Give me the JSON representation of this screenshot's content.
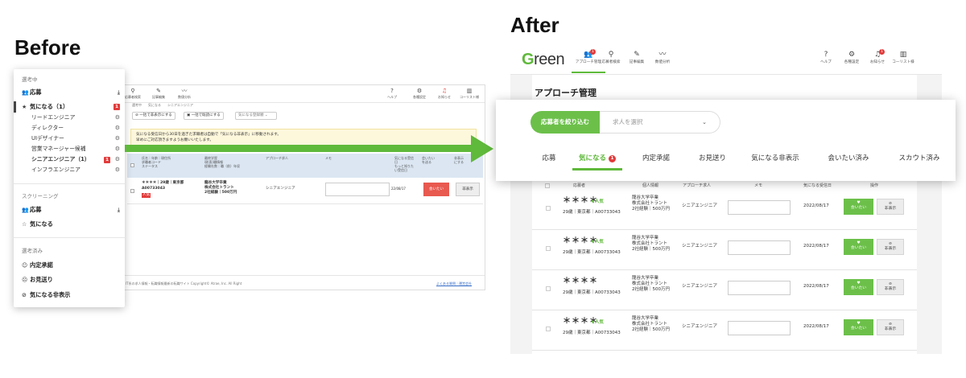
{
  "labels": {
    "before": "Before",
    "after": "After"
  },
  "colors": {
    "accent_green": "#5fb93b",
    "badge_red": "#e23b3b"
  },
  "before": {
    "nav": [
      {
        "icon": "search-icon",
        "glyph": "⚲",
        "label": "応募者検索"
      },
      {
        "icon": "pen-icon",
        "glyph": "✎",
        "label": "記事編集"
      },
      {
        "icon": "chart-icon",
        "glyph": "〰",
        "label": "数値分析"
      },
      {
        "icon": "help-icon",
        "glyph": "?",
        "label": "ヘルプ"
      },
      {
        "icon": "gear-icon",
        "glyph": "⚙",
        "label": "各種設定"
      },
      {
        "icon": "bell-icon",
        "glyph": "♫",
        "label": "お知らせ"
      },
      {
        "icon": "building-icon",
        "glyph": "▥",
        "label": "コーリスト様"
      }
    ],
    "crumbs": "選考中　　気になる　　シニアエンジニア",
    "bulk_hide": "一括で非表示にする",
    "bulk_read": "一括で既読にする",
    "sort": "気になる登録順",
    "notice_line1": "気になる受信日から30日を過ぎた求職者は自動で「気になる非表示」に移動されます。",
    "notice_line2": "早めにご対応頂きますようお願いいたします。",
    "thead": {
      "col1": "氏名｜年齢｜現住所\n求職者コード\nステータス",
      "col2": "最終学歴\n現(直)職情報\n経験社数｜職（前）年収",
      "col3": "アプローチ求人",
      "col4": "メモ",
      "col5": "気になる受信\n日\nもっと知りた\nい受信日",
      "col6": "会いたい\nを送る",
      "col7": "非表示\nにする"
    },
    "row": {
      "name": "＊＊＊＊｜29歳｜東京都",
      "code": "A00733043",
      "status": "人気",
      "edu": "龍谷大学卒業\n株式会社トラント\n2社経験｜500万円",
      "job": "シニアエンジニア",
      "date": "22/08/17",
      "meet": "会いたい",
      "hide": "非表示"
    },
    "footer_left": "IT系の求人情報・転職情報最新の転職サイト Copyright© Atrae, Inc. All Right",
    "footer_right": "よくある質問｜運営会社",
    "sidebar": {
      "sec1": "選考中",
      "apply": "応募",
      "interest": "気になる（1）",
      "interest_badge": "1",
      "subs": [
        {
          "label": "リードエンジニア",
          "badge": ""
        },
        {
          "label": "ディレクター",
          "badge": ""
        },
        {
          "label": "UIデザイナー",
          "badge": ""
        },
        {
          "label": "営業マネージャー候補",
          "badge": ""
        },
        {
          "label": "シニアエンジニア（1）",
          "badge": "1"
        },
        {
          "label": "インフラエンジニア",
          "badge": ""
        }
      ],
      "sec2": "スクリーニング",
      "screen_apply": "応募",
      "screen_interest": "気になる",
      "sec3": "選考済み",
      "offer": "内定承諾",
      "decline": "お見送り",
      "hidden": "気になる非表示"
    }
  },
  "after": {
    "logo": "Green",
    "nav": [
      {
        "icon": "users-icon",
        "glyph": "👥",
        "label": "アプローチ管理",
        "badge": "1"
      },
      {
        "icon": "search-icon",
        "glyph": "⚲",
        "label": "応募者検索",
        "badge": ""
      },
      {
        "icon": "pen-icon",
        "glyph": "✎",
        "label": "記事編集",
        "badge": ""
      },
      {
        "icon": "chart-icon",
        "glyph": "〰",
        "label": "数値分析",
        "badge": ""
      },
      {
        "icon": "help-icon",
        "glyph": "?",
        "label": "ヘルプ",
        "badge": ""
      },
      {
        "icon": "gear-icon",
        "glyph": "⚙",
        "label": "各種設定",
        "badge": ""
      },
      {
        "icon": "bell-icon",
        "glyph": "♫",
        "label": "お知らせ",
        "badge": "1"
      },
      {
        "icon": "building-icon",
        "glyph": "▥",
        "label": "コーリスト様",
        "badge": ""
      }
    ],
    "title": "アプローチ管理",
    "filter_button": "応募者を絞り込む",
    "select_placeholder": "求人を選択",
    "tabs": [
      {
        "label": "応募",
        "badge": ""
      },
      {
        "label": "気になる",
        "badge": "1"
      },
      {
        "label": "内定承諾",
        "badge": ""
      },
      {
        "label": "お見送り",
        "badge": ""
      },
      {
        "label": "気になる非表示",
        "badge": ""
      },
      {
        "label": "会いたい済み",
        "badge": ""
      },
      {
        "label": "スカウト済み",
        "badge": ""
      }
    ],
    "thead": [
      "応募者",
      "個人情報",
      "アプローチ求人",
      "メモ",
      "気になる受信日",
      "操作"
    ],
    "rows": [
      {
        "name": "＊＊＊＊",
        "pop": "♦人気",
        "info": "29歳｜東京都｜A00733043",
        "edu": "龍谷大学卒業\n株式会社トラント\n2社経験｜500万円",
        "job": "シニアエンジニア",
        "date": "2022/08/17",
        "meet": "会いたい",
        "hide": "非表示"
      },
      {
        "name": "＊＊＊＊",
        "pop": "♦人気",
        "info": "29歳｜東京都｜A00733043",
        "edu": "龍谷大学卒業\n株式会社トラント\n2社経験｜500万円",
        "job": "シニアエンジニア",
        "date": "2022/08/17",
        "meet": "会いたい",
        "hide": "非表示"
      },
      {
        "name": "＊＊＊＊",
        "pop": "",
        "info": "29歳｜東京都｜A00733043",
        "edu": "龍谷大学卒業\n株式会社トラント\n2社経験｜500万円",
        "job": "シニアエンジニア",
        "date": "2022/08/17",
        "meet": "会いたい",
        "hide": "非表示"
      },
      {
        "name": "＊＊＊＊",
        "pop": "♦人気",
        "info": "29歳｜東京都｜A00733043",
        "edu": "龍谷大学卒業\n株式会社トラント\n2社経験｜500万円",
        "job": "シニアエンジニア",
        "date": "2022/08/17",
        "meet": "会いたい",
        "hide": "非表示"
      }
    ]
  }
}
